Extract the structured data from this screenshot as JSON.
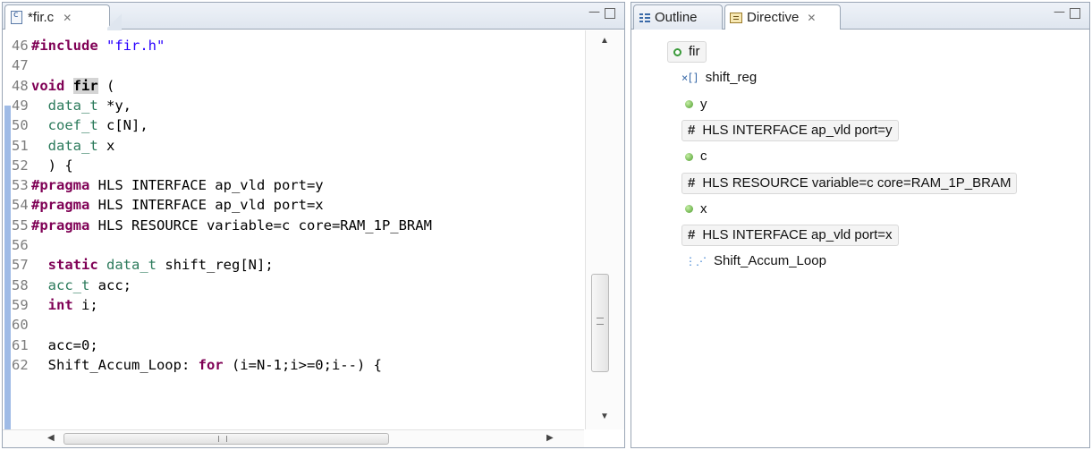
{
  "editor": {
    "tab_label": "*fir.c",
    "tab_close": "✕",
    "code_lines": [
      {
        "n": "46",
        "segs": [
          {
            "c": "kw",
            "t": "#include"
          },
          {
            "c": "",
            "t": " "
          },
          {
            "c": "st",
            "t": "\"fir.h\""
          }
        ]
      },
      {
        "n": "47",
        "segs": []
      },
      {
        "n": "48",
        "segs": [
          {
            "c": "kw",
            "t": "void"
          },
          {
            "c": "",
            "t": " "
          },
          {
            "c": "fn-hl",
            "t": "fir"
          },
          {
            "c": "",
            "t": " ("
          }
        ]
      },
      {
        "n": "49",
        "segs": [
          {
            "c": "",
            "t": "  "
          },
          {
            "c": "tp",
            "t": "data_t"
          },
          {
            "c": "",
            "t": " *y,"
          }
        ]
      },
      {
        "n": "50",
        "segs": [
          {
            "c": "",
            "t": "  "
          },
          {
            "c": "tp",
            "t": "coef_t"
          },
          {
            "c": "",
            "t": " c[N],"
          }
        ]
      },
      {
        "n": "51",
        "segs": [
          {
            "c": "",
            "t": "  "
          },
          {
            "c": "tp",
            "t": "data_t"
          },
          {
            "c": "",
            "t": " x"
          }
        ]
      },
      {
        "n": "52",
        "segs": [
          {
            "c": "",
            "t": "  ) {"
          }
        ]
      },
      {
        "n": "53",
        "segs": [
          {
            "c": "kw",
            "t": "#pragma"
          },
          {
            "c": "",
            "t": " HLS INTERFACE ap_vld port=y"
          }
        ]
      },
      {
        "n": "54",
        "segs": [
          {
            "c": "kw",
            "t": "#pragma"
          },
          {
            "c": "",
            "t": " HLS INTERFACE ap_vld port=x"
          }
        ]
      },
      {
        "n": "55",
        "segs": [
          {
            "c": "kw",
            "t": "#pragma"
          },
          {
            "c": "",
            "t": " HLS RESOURCE variable=c core=RAM_1P_BRAM"
          }
        ]
      },
      {
        "n": "56",
        "segs": []
      },
      {
        "n": "57",
        "segs": [
          {
            "c": "",
            "t": "  "
          },
          {
            "c": "kw",
            "t": "static"
          },
          {
            "c": "",
            "t": " "
          },
          {
            "c": "tp",
            "t": "data_t"
          },
          {
            "c": "",
            "t": " shift_reg[N];"
          }
        ]
      },
      {
        "n": "58",
        "segs": [
          {
            "c": "",
            "t": "  "
          },
          {
            "c": "tp",
            "t": "acc_t"
          },
          {
            "c": "",
            "t": " acc;"
          }
        ]
      },
      {
        "n": "59",
        "segs": [
          {
            "c": "",
            "t": "  "
          },
          {
            "c": "kw",
            "t": "int"
          },
          {
            "c": "",
            "t": " i;"
          }
        ]
      },
      {
        "n": "60",
        "segs": []
      },
      {
        "n": "61",
        "segs": [
          {
            "c": "",
            "t": "  acc=0;"
          }
        ]
      },
      {
        "n": "62",
        "segs": [
          {
            "c": "",
            "t": "  Shift_Accum_Loop: "
          },
          {
            "c": "kw",
            "t": "for"
          },
          {
            "c": "",
            "t": " (i=N-1;i>=0;i--) {"
          }
        ]
      }
    ]
  },
  "right_panel": {
    "tabs": {
      "outline": "Outline",
      "directive": "Directive",
      "directive_close": "✕"
    },
    "tree": [
      {
        "icon": "dot-hollow",
        "label": "fir",
        "boxed": true
      },
      {
        "icon": "array-icon",
        "label": "shift_reg",
        "boxed": false
      },
      {
        "icon": "dot-green",
        "label": "y",
        "boxed": false
      },
      {
        "icon": "hash",
        "label": "HLS INTERFACE ap_vld port=y",
        "boxed": true
      },
      {
        "icon": "dot-green",
        "label": "c",
        "boxed": false
      },
      {
        "icon": "hash",
        "label": "HLS RESOURCE variable=c core=RAM_1P_BRAM",
        "boxed": true
      },
      {
        "icon": "dot-green",
        "label": "x",
        "boxed": false
      },
      {
        "icon": "hash",
        "label": "HLS INTERFACE ap_vld port=x",
        "boxed": true
      },
      {
        "icon": "loop-icon",
        "label": "Shift_Accum_Loop",
        "boxed": false
      }
    ]
  },
  "window_controls": {
    "minimize": "—",
    "maximize": "□"
  }
}
